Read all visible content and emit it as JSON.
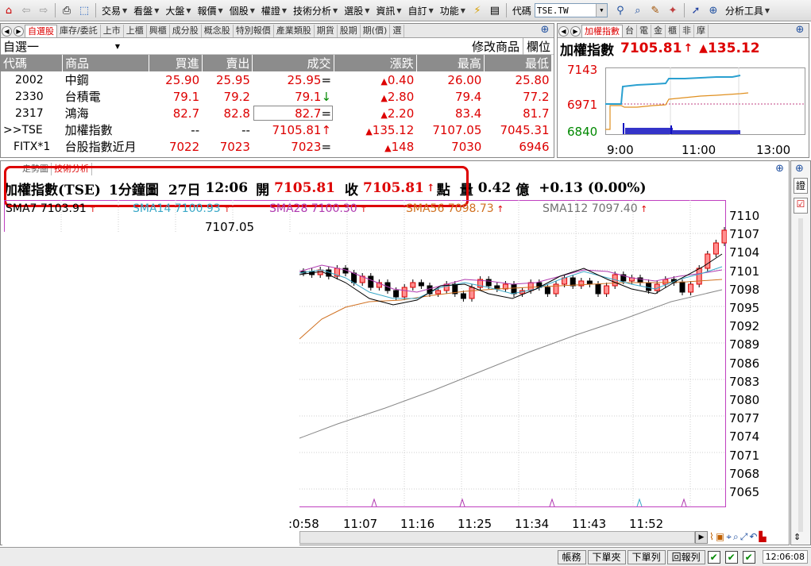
{
  "menubar": {
    "items": [
      "交易",
      "看盤",
      "大盤",
      "報價",
      "個股",
      "權證",
      "技術分析",
      "選股",
      "資訊",
      "自訂",
      "功能"
    ],
    "code_label": "代碼",
    "code_value": "TSE.TW",
    "analysis_tools": "分析工具"
  },
  "quote_panel": {
    "tabs": [
      "自選股",
      "庫存/委託",
      "上市",
      "上櫃",
      "興櫃",
      "成分股",
      "概念股",
      "特別報價",
      "產業類股",
      "期貨",
      "股期",
      "期(價)",
      "選"
    ],
    "group_name": "自選一",
    "modify_label": "修改商品",
    "columns_label": "欄位",
    "headers": [
      "代碼",
      "商品",
      "買進",
      "賣出",
      "成交",
      "漲跌",
      "最高",
      "最低"
    ],
    "rows": [
      {
        "code": "2002",
        "name": "中鋼",
        "bid": "25.90",
        "ask": "25.95",
        "last": "25.95",
        "mark": "=",
        "chg": "0.40",
        "high": "26.00",
        "low": "25.80"
      },
      {
        "code": "2330",
        "name": "台積電",
        "bid": "79.1",
        "ask": "79.2",
        "last": "79.1",
        "mark": "↓",
        "chg": "2.80",
        "high": "79.4",
        "low": "77.2"
      },
      {
        "code": "2317",
        "name": "鴻海",
        "bid": "82.7",
        "ask": "82.8",
        "last": "82.7",
        "mark": "=",
        "chg": "2.20",
        "high": "83.4",
        "low": "81.7"
      },
      {
        "code": ">>TSE",
        "name": "加權指數",
        "bid": "--",
        "ask": "--",
        "last": "7105.81",
        "mark": "↑",
        "chg": "135.12",
        "high": "7107.05",
        "low": "7045.31"
      },
      {
        "code": "FITX*1",
        "name": "台股指數近月",
        "bid": "7022",
        "ask": "7023",
        "last": "7023",
        "mark": "=",
        "chg": "148",
        "high": "7030",
        "low": "6946"
      }
    ]
  },
  "mini_chart": {
    "tabs": [
      "加權指數",
      "台",
      "電",
      "金",
      "櫃",
      "非",
      "摩"
    ],
    "title": "加權指數",
    "price": "7105.81",
    "arrow": "↑",
    "change": "135.12",
    "y_labels": [
      "7143",
      "6971",
      "6840"
    ],
    "x_labels": [
      "9:00",
      "11:00",
      "13:00"
    ]
  },
  "tech_chart": {
    "tabs": [
      "走勢圖",
      "技術分析"
    ],
    "header": {
      "name": "加權指數(TSE)",
      "period": "1分鐘圖",
      "date": "27日",
      "time": "12:06",
      "open_label": "開",
      "open": "7105.81",
      "close_label": "收",
      "close": "7105.81",
      "point_label": "點",
      "volume_label": "量",
      "volume": "0.42",
      "volume_unit": "億",
      "change": "+0.13",
      "change_pct": "(0.00%)"
    },
    "sma": [
      {
        "label": "SMA7 7103.91",
        "color": "#000000"
      },
      {
        "label": "SMA14 7100.93",
        "color": "#3aa8c8"
      },
      {
        "label": "SMA28 7100.30",
        "color": "#b03ab0"
      },
      {
        "label": "SMA56 7098.73",
        "color": "#d07020"
      },
      {
        "label": "SMA112 7097.40",
        "color": "#707070"
      }
    ],
    "high_marker": "7107.05",
    "y_labels": [
      "7110",
      "7107",
      "7104",
      "7101",
      "7098",
      "7095",
      "7092",
      "7089",
      "7086",
      "7083",
      "7080",
      "7077",
      "7074",
      "7071",
      "7068",
      "7065"
    ],
    "x_labels": [
      ":0:58",
      "11:07",
      "11:16",
      "11:25",
      "11:34",
      "11:43",
      "11:52"
    ],
    "side_tab": "證"
  },
  "statusbar": {
    "buttons": [
      "帳務",
      "下單夾",
      "下單列",
      "回報列"
    ],
    "clock": "12:06:08"
  },
  "colors": {
    "up": "#dd0000",
    "down": "#008800",
    "highlight": "#cc0000"
  }
}
